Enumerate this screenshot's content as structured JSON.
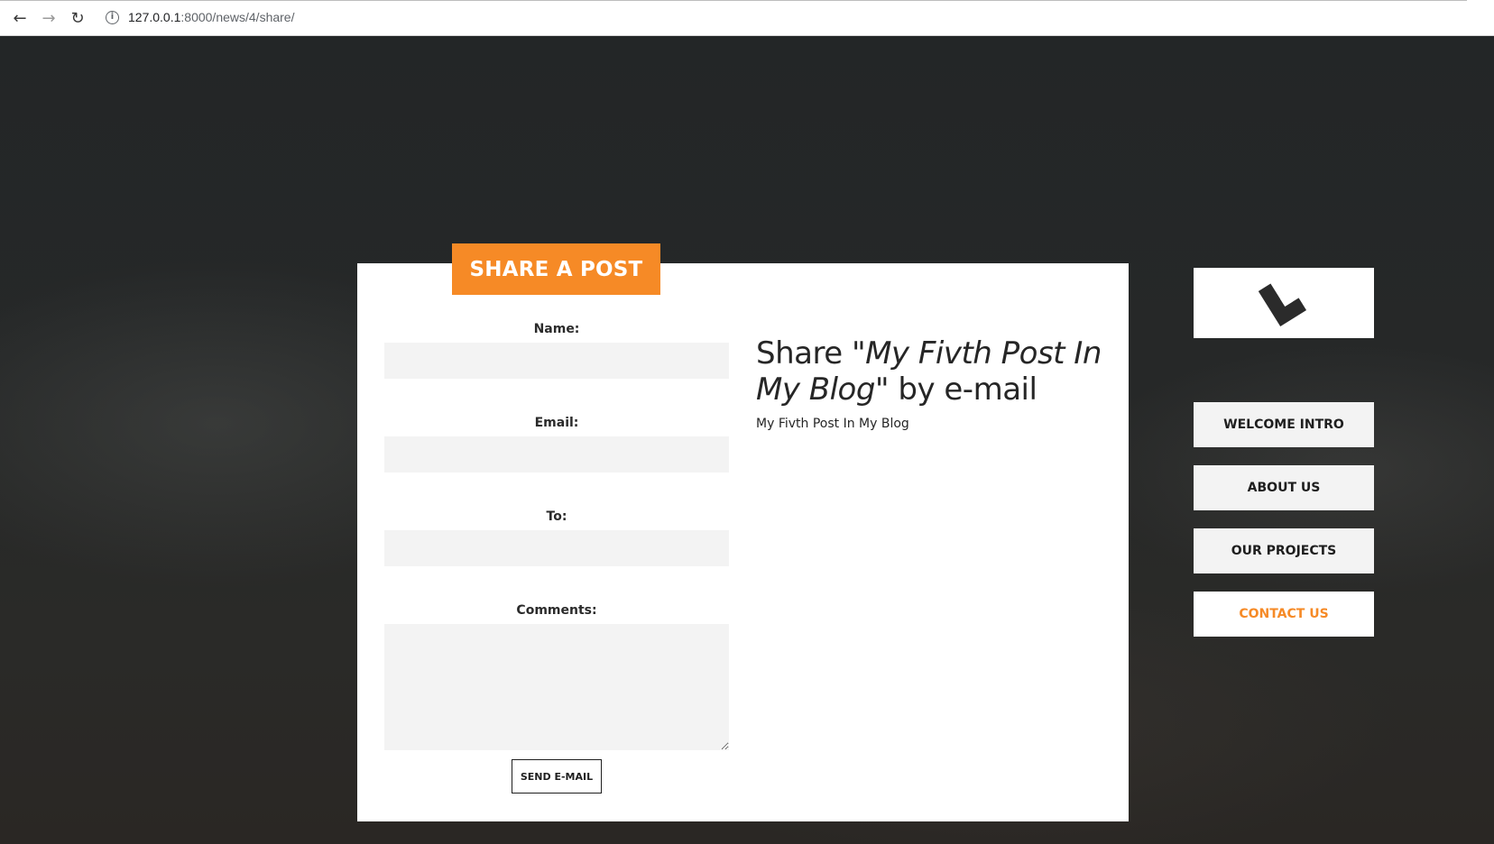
{
  "browser": {
    "url_host": "127.0.0.1",
    "url_path": ":8000/news/4/share/",
    "back_icon": "arrow-left-icon",
    "forward_icon": "arrow-right-icon",
    "reload_icon": "reload-icon",
    "info_icon": "info-icon"
  },
  "card": {
    "badge": "SHARE A POST"
  },
  "form": {
    "name_label": "Name:",
    "name_value": "",
    "email_label": "Email:",
    "email_value": "",
    "to_label": "To:",
    "to_value": "",
    "comments_label": "Comments:",
    "comments_value": "",
    "send_label": "SEND E-MAIL"
  },
  "share": {
    "prefix": "Share ",
    "post_title_quoted": "\"My Fivth Post In My Blog\"",
    "suffix": " by e-mail",
    "post_title": "My Fivth Post In My Blog"
  },
  "sidebar": {
    "logo_icon": "brand-logo-icon",
    "items": [
      {
        "label": "WELCOME INTRO",
        "active": false
      },
      {
        "label": "ABOUT US",
        "active": false
      },
      {
        "label": "OUR PROJECTS",
        "active": false
      },
      {
        "label": "CONTACT US",
        "active": true
      }
    ]
  },
  "colors": {
    "accent": "#f68a26",
    "field_bg": "#f3f3f3",
    "page_bg": "#2a2c2c"
  }
}
